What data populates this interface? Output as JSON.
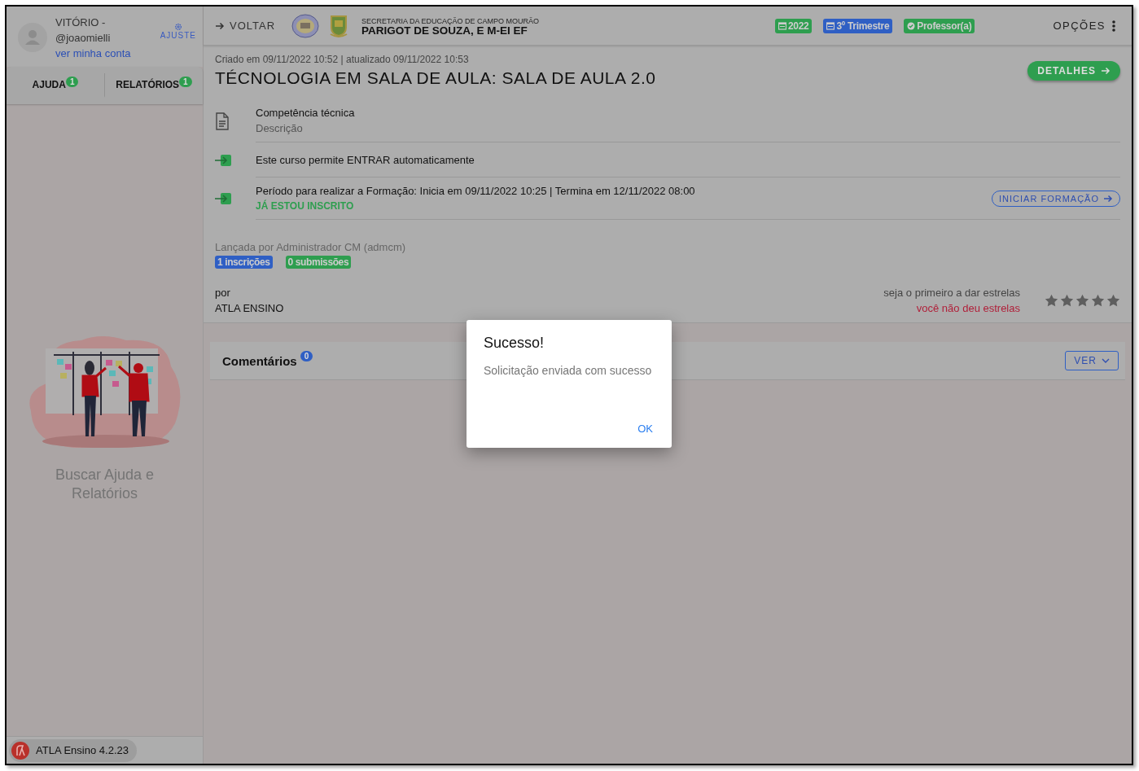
{
  "user": {
    "name": "VITÓRIO -",
    "handle": "@joaomielli",
    "account_link": "ver minha conta",
    "settings": "AJUSTE"
  },
  "sidebar_tabs": [
    {
      "label": "AJUDA",
      "count": "1",
      "selected": false
    },
    {
      "label": "RELATÓRIOS",
      "count": "1",
      "selected": false
    }
  ],
  "help_panel": {
    "title": "Buscar Ajuda e Relatórios"
  },
  "version": "ATLA Ensino 4.2.23",
  "topbar": {
    "back": "VOLTAR",
    "school_subtitle": "SECRETARIA DA EDUCAÇÃO DE CAMPO MOURÃO",
    "school_name": "PARIGOT DE SOUZA, E M-EI EF",
    "options": "OPÇÕES",
    "chips": [
      {
        "label": "2022",
        "kind": "calendar",
        "color": "#2e9e4f"
      },
      {
        "label": "3º Trimestre",
        "kind": "calendar",
        "color": "#2f5fc4"
      },
      {
        "label": "Professor(a)",
        "kind": "check",
        "color": "#2e9e4f"
      }
    ]
  },
  "course": {
    "meta": "Criado em 09/11/2022 10:52 | atualizado 09/11/2022 10:53",
    "title": "TÉCNOLOGIA EM SALA DE AULA: SALA DE AULA 2.0",
    "details_button": "DETALHES",
    "info": [
      {
        "kind": "document",
        "title": "Competência técnica",
        "subtitle": "Descrição"
      },
      {
        "kind": "enter",
        "title": "Este curso permite ENTRAR automaticamente"
      },
      {
        "kind": "enter",
        "title": "Período para realizar a Formação: Inicia em 09/11/2022 10:25 | Termina em 12/11/2022 08:00",
        "status": "JÁ ESTOU INSCRITO",
        "action": "INICIAR FORMAÇÃO"
      }
    ],
    "launched_by": "Lançada por Administrador CM (admcm)",
    "badges": [
      {
        "label": "1 inscrições",
        "color": "#2f5fc4"
      },
      {
        "label": "0 submissões",
        "color": "#2e9e4f"
      }
    ],
    "by_label": "por",
    "author": "ATLA ENSINO",
    "rating_prompt": "seja o primeiro a dar estrelas",
    "rating_status": "você não deu estrelas",
    "stars": 0
  },
  "comments": {
    "title": "Comentários",
    "count": "0",
    "view_button": "VER"
  },
  "dialog": {
    "title": "Sucesso!",
    "message": "Solicitação enviada com sucesso",
    "button": "OK"
  }
}
